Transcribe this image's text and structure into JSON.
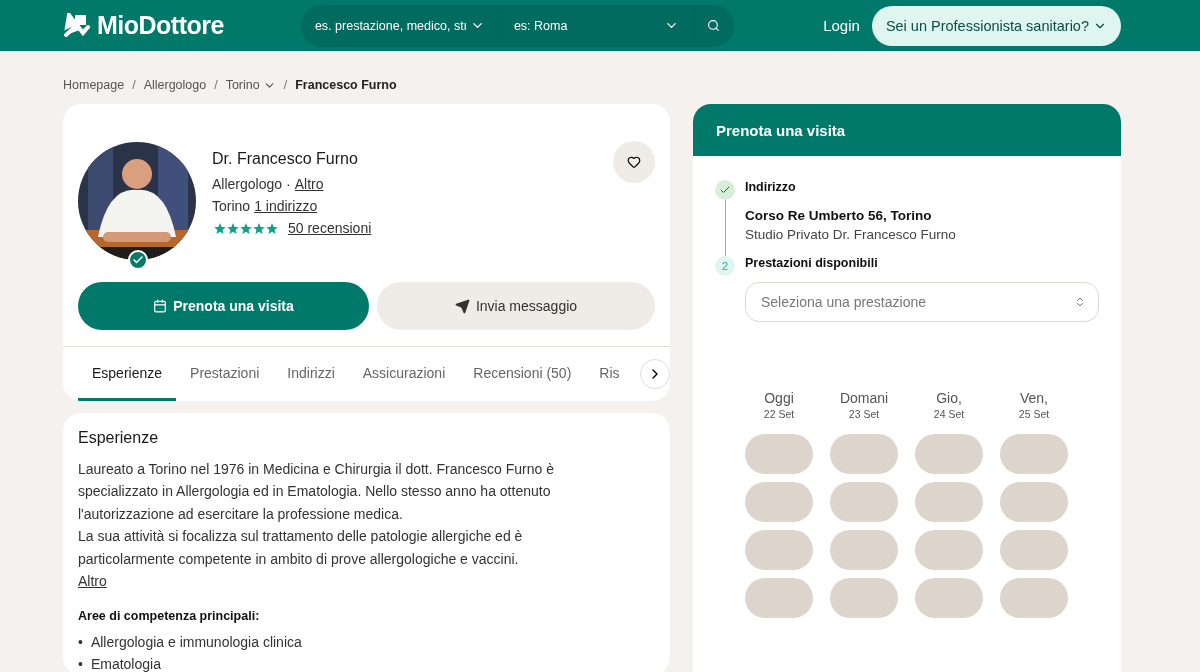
{
  "header": {
    "logo": "MioDottore",
    "search": {
      "query_placeholder": "es. prestazione, medico, stı",
      "location_placeholder": "es: Roma"
    },
    "login": "Login",
    "pro_button": "Sei un Professionista sanitario?"
  },
  "breadcrumb": {
    "separator": "/",
    "items": [
      {
        "label": "Homepage",
        "dropdown": false
      },
      {
        "label": "Allergologo",
        "dropdown": false
      },
      {
        "label": "Torino",
        "dropdown": true
      },
      {
        "label": "Francesco Furno",
        "dropdown": false
      }
    ]
  },
  "profile": {
    "name": "Dr. Francesco Furno",
    "specialty": "Allergologo",
    "specialty_separator": "·",
    "specialty_link": "Altro",
    "city": "Torino",
    "address_link": "1 indirizzo",
    "stars": 5,
    "reviews_link": "50 recensioni",
    "verified": true,
    "book_button": "Prenota una visita",
    "message_button": "Invia messaggio"
  },
  "tabs": [
    {
      "label": "Esperienze",
      "selected": true
    },
    {
      "label": "Prestazioni",
      "selected": false
    },
    {
      "label": "Indirizzi",
      "selected": false
    },
    {
      "label": "Assicurazioni",
      "selected": false
    },
    {
      "label": "Recensioni (50)",
      "selected": false
    },
    {
      "label": "Ris",
      "selected": false
    }
  ],
  "experience": {
    "title": "Esperienze",
    "paragraphs": [
      "Laureato a Torino nel 1976 in Medicina e Chirurgia il dott. Francesco Furno è specializzato in Allergologia ed in Ematologia. Nello stesso anno ha ottenuto l'autorizzazione ad esercitare la professione medica.",
      "La sua attività si focalizza sul trattamento delle patologie allergiche ed è particolarmente competente in ambito di prove allergologiche e vaccini."
    ],
    "more_link": "Altro",
    "areas_title": "Aree di competenza principali:",
    "bullet": "•",
    "areas": [
      "Allergologia e immunologia clinica",
      "Ematologia"
    ]
  },
  "booking": {
    "title": "Prenota una visita",
    "steps": [
      {
        "label": "Indirizzo",
        "done": true
      },
      {
        "number": "2",
        "label": "Prestazioni disponibili",
        "done": false
      }
    ],
    "address": "Corso Re Umberto 56, Torino",
    "clinic": "Studio Privato Dr. Francesco Furno",
    "select_placeholder": "Seleziona una prestazione",
    "days": [
      {
        "day": "Oggi",
        "date": "22 Set"
      },
      {
        "day": "Domani",
        "date": "23 Set"
      },
      {
        "day": "Gio,",
        "date": "24 Set"
      },
      {
        "day": "Ven,",
        "date": "25 Set"
      }
    ]
  }
}
